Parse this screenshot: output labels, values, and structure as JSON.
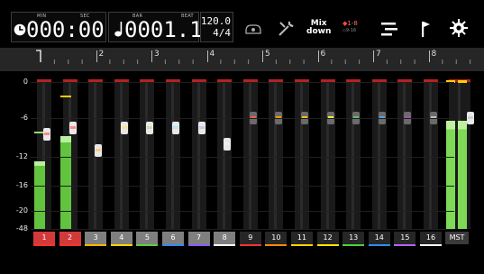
{
  "header": {
    "counter_label_min": "MIN",
    "counter_label_sec": "SEC",
    "time_value": "000:00",
    "bar_label": "BAR",
    "beat_label": "BEAT",
    "bar_value": "0001.1",
    "tempo": "120.0",
    "time_signature": "4/4",
    "mixdown_line1": "Mix",
    "mixdown_line2": "down",
    "track_range_top": "1-8",
    "track_range_bottom": "9-16"
  },
  "ruler": {
    "marks": [
      "2",
      "3",
      "4",
      "5",
      "6",
      "7",
      "8"
    ]
  },
  "scale": {
    "labels": [
      "0",
      "-6",
      "-12",
      "-16",
      "-20",
      "-48"
    ]
  },
  "channels": [
    {
      "label": "1",
      "color": "#d23a3a",
      "active": true
    },
    {
      "label": "2",
      "color": "#d23a3a",
      "active": true
    },
    {
      "label": "3",
      "color": "#7f7f7f",
      "active": false
    },
    {
      "label": "4",
      "color": "#7f7f7f",
      "active": false
    },
    {
      "label": "5",
      "color": "#7f7f7f",
      "active": false
    },
    {
      "label": "6",
      "color": "#7f7f7f",
      "active": false
    },
    {
      "label": "7",
      "color": "#7f7f7f",
      "active": false
    },
    {
      "label": "8",
      "color": "#7f7f7f",
      "active": false
    },
    {
      "label": "9",
      "color": "#262626",
      "active": false
    },
    {
      "label": "10",
      "color": "#262626",
      "active": false
    },
    {
      "label": "11",
      "color": "#262626",
      "active": false
    },
    {
      "label": "12",
      "color": "#262626",
      "active": false
    },
    {
      "label": "13",
      "color": "#262626",
      "active": false
    },
    {
      "label": "14",
      "color": "#262626",
      "active": false
    },
    {
      "label": "15",
      "color": "#262626",
      "active": false
    },
    {
      "label": "16",
      "color": "#262626",
      "active": false
    },
    {
      "label": "MST",
      "color": "#3a3a3a",
      "active": false
    }
  ],
  "channel_underline_colors": [
    "#ff3030",
    "#ff3030",
    "#ffb400",
    "#ffd400",
    "#5ad13a",
    "#2d8cff",
    "#8a5cff",
    "#ffffff",
    "#ff3030",
    "#ff8a00",
    "#ffd400",
    "#ffe600",
    "#4bd13a",
    "#2d8cff",
    "#b066ff",
    "#ffffff"
  ],
  "meter_levels": [
    0.45,
    0.62,
    0,
    0,
    0,
    0,
    0,
    0,
    0,
    0,
    0,
    0,
    0,
    0,
    0,
    0,
    0.72
  ],
  "fader_positions_db": [
    -8.5,
    -7.5,
    -11,
    -7.5,
    -7.5,
    -7.5,
    -7.5,
    -10,
    -6,
    -6,
    -6,
    -6,
    -6,
    -6,
    -6,
    -6,
    -6
  ],
  "fader_colors": [
    "#ff8a80",
    "#ff8a80",
    "#ffcc80",
    "#ffe082",
    "#c5e1a5",
    "#b3e5fc",
    "#d1c4e9",
    "#eeeeee",
    "#ff5252",
    "#ff9800",
    "#ffc107",
    "#ffeb3b",
    "#66bb6a",
    "#42a5f5",
    "#ab47bc",
    "#bdbdbd",
    "#cfcfcf"
  ]
}
